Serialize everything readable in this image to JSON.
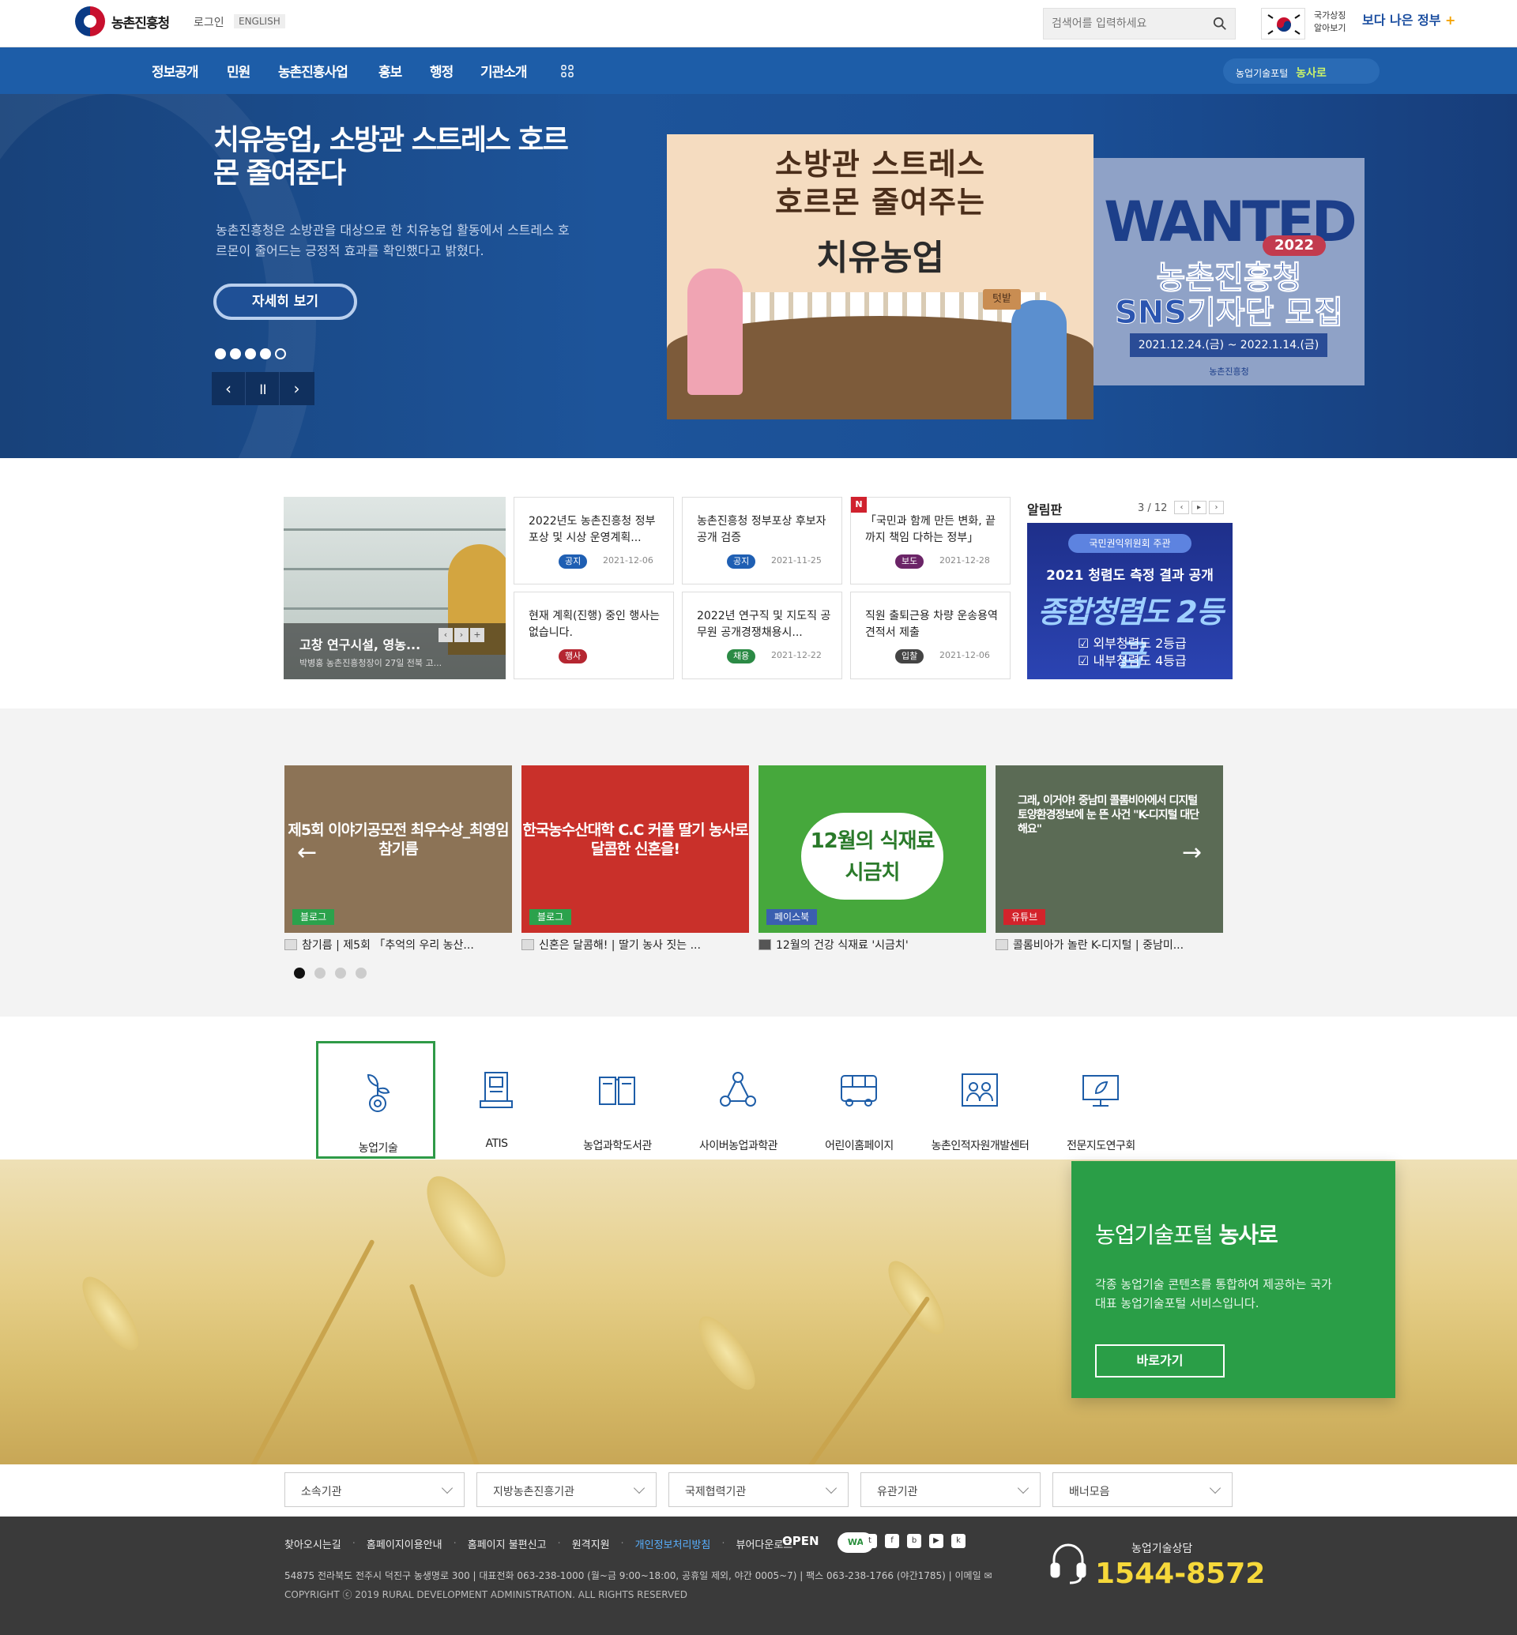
{
  "header": {
    "agency_name": "농촌진흥청",
    "login": "로그인",
    "english": "ENGLISH",
    "search_placeholder": "검색어를 입력하세요",
    "symbol_label_1": "국가상징",
    "symbol_label_2": "알아보기",
    "gov_slogan": "보다 나은 정부"
  },
  "nav": {
    "items": [
      "정보공개",
      "민원",
      "농촌진흥사업",
      "홍보",
      "행정",
      "기관소개"
    ],
    "portal_label": "농업기술포털",
    "portal_brand": "농사로"
  },
  "hero": {
    "title": "치유농업, 소방관 스트레스 호르몬 줄여준다",
    "description": "농촌진흥청은 소방관을 대상으로 한 치유농업 활동에서 스트레스 호르몬이 줄어드는 긍정적 효과를 확인했다고 밝혔다.",
    "button": "자세히 보기",
    "slide_count": 5,
    "active_slide": 5,
    "image1": {
      "line1": "소방관 스트레스",
      "line2": "호르몬 줄여주는",
      "line3": "치유농업",
      "sign": "텃밭"
    },
    "image2": {
      "big": "WANTED",
      "year": "2022",
      "line1": "농촌진흥청",
      "line2": "SNS기자단 모집",
      "dates": "2021.12.24.(금) ~ 2022.1.14.(금)",
      "footer": "농촌진흥청"
    }
  },
  "news": {
    "photo_title": "고창 연구시설, 영농...",
    "photo_sub": "박병홍 농촌진흥청장이 27일 전북 고...",
    "cards": [
      {
        "title": "2022년도 농촌진흥청 정부포상 및 시상 운영계획...",
        "tag": "공지",
        "tag_color": "#1f5fb3",
        "date": "2021-12-06"
      },
      {
        "title": "농촌진흥청 정부포상 후보자 공개 검증",
        "tag": "공지",
        "tag_color": "#1f5fb3",
        "date": "2021-11-25"
      },
      {
        "title": "「국민과 함께 만든 변화, 끝까지 책임 다하는 정부」",
        "tag": "보도",
        "tag_color": "#6b2467",
        "date": "2021-12-28"
      },
      {
        "title": "현재 계획(진행) 중인 행사는 없습니다.",
        "tag": "행사",
        "tag_color": "#b52631",
        "date": ""
      },
      {
        "title": "2022년 연구직 및 지도직 공무원 공개경쟁채용시...",
        "tag": "채용",
        "tag_color": "#2b8a45",
        "date": "2021-12-22"
      },
      {
        "title": "직원 출퇴근용 차량 운송용역 견적서 제출",
        "tag": "입찰",
        "tag_color": "#444444",
        "date": "2021-12-06"
      }
    ],
    "new_badge": "N",
    "board_title": "알림판",
    "board_count": "3 / 12",
    "board_img": {
      "host": "국민권익위원회 주관",
      "headline": "2021 청렴도 측정 결과 공개",
      "grade": "종합청렴도 2등급",
      "ext": "외부청렴도 2등급",
      "int": "내부청렴도 4등급"
    }
  },
  "sns": {
    "items": [
      {
        "overlay": "제5회 이야기공모전 최우수상_최영임 참기름",
        "label": "블로그",
        "label_color": "#2ba24c",
        "caption": "참기름 | 제5회 「추억의 우리 농산...",
        "bg": "#8c7356"
      },
      {
        "overlay": "한국농수산대학 C.C 커플 딸기 농사로 달콤한 신혼을!",
        "label": "블로그",
        "label_color": "#2ba24c",
        "caption": "신혼은 달콤해! | 딸기 농사 짓는 ...",
        "bg": "#c9302a"
      },
      {
        "overlay": "12월의 식재료 시금치",
        "label": "페이스북",
        "label_color": "#3b5fb0",
        "caption": "12월의 건강 식재료 '시금치'",
        "bg": "#46a83c"
      },
      {
        "overlay": "그래, 이거야! 중남미 콜롬비아에서 디지털 토양환경정보에 눈 뜬 사건 \"K-디지털 대단해요\"",
        "label": "유튜브",
        "label_color": "#d3232b",
        "caption": "콜롬비아가 놀란 K-디지털 | 중남미...",
        "bg": "#5b6b55"
      }
    ],
    "page_dots": 4
  },
  "sites": [
    {
      "label": "농업기술",
      "icon": "seedling-icon"
    },
    {
      "label": "ATIS",
      "icon": "kiosk-icon"
    },
    {
      "label": "농업과학도서관",
      "icon": "book-icon"
    },
    {
      "label": "사이버농업과학관",
      "icon": "network-icon"
    },
    {
      "label": "어린이홈페이지",
      "icon": "bus-icon"
    },
    {
      "label": "농촌인적자원개발센터",
      "icon": "people-icon"
    },
    {
      "label": "전문지도연구회",
      "icon": "monitor-icon"
    }
  ],
  "nongsaro": {
    "title_prefix": "농업기술포털",
    "title_brand": "농사로",
    "description": "각종 농업기술 콘텐츠를 통합하여 제공하는 국가대표 농업기술포털 서비스입니다.",
    "button": "바로가기"
  },
  "selects": [
    "소속기관",
    "지방농촌진흥기관",
    "국제협력기관",
    "유관기관",
    "배너모음"
  ],
  "footer": {
    "links": [
      "찾아오시는길",
      "홈페이지이용안내",
      "홈페이지 불편신고",
      "원격지원",
      "개인정보처리방침",
      "뷰어다운로드"
    ],
    "open_label": "OPEN",
    "wa_label": "WA",
    "address": "54875 전라북도 전주시 덕진구 농생명로 300  |  대표전화 063-238-1000 (월~금 9:00~18:00, 공휴일 제외, 야간 0005~7)  |  팩스 063-238-1766 (야간1785)  |  이메일",
    "copyright": "COPYRIGHT ⓒ 2019 RURAL DEVELOPMENT ADMINISTRATION. ALL RIGHTS RESERVED",
    "tel_label": "농업기술상담",
    "tel": "1544-8572"
  }
}
